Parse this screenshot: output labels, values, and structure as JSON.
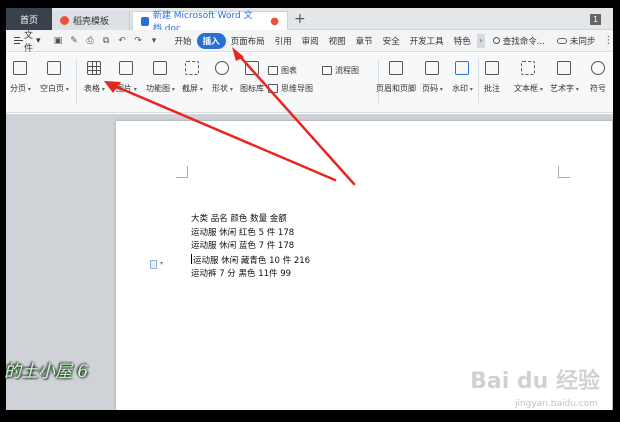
{
  "tabbar": {
    "tabs": [
      {
        "label": "首页"
      },
      {
        "label": "稻壳模板"
      },
      {
        "label": "新建 Microsoft Word 文档.doc"
      }
    ],
    "new_tab": "+",
    "badge": "1"
  },
  "menubar": {
    "file_label": "文件",
    "file_arrow": "▾",
    "tabs": [
      "开始",
      "插入",
      "页面布局",
      "引用",
      "审阅",
      "视图",
      "章节",
      "安全",
      "开发工具",
      "特色"
    ],
    "active_tab": "插入",
    "more": "›",
    "search": "查找命令...",
    "sync": "未同步",
    "kebab": "⋮"
  },
  "ribbon": {
    "page": "分页",
    "blank_page": "空白页",
    "table": "表格",
    "picture": "图片",
    "function_chart": "功能图",
    "screenshot": "截屏",
    "shape": "形状",
    "icon_lib": "图标库",
    "chart": "图表",
    "mindmap": "思维导图",
    "flowchart": "流程图",
    "header_footer": "页眉和页脚",
    "page_number": "页码",
    "watermark": "水印",
    "comment": "批注",
    "textbox": "文本框",
    "wordart": "艺术字",
    "symbol": "符号"
  },
  "document": {
    "lines": [
      "大类 品名 颜色 数量 金额",
      "运动服 休闲 红色 5 件 178",
      "运动服 休闲 蓝色 7 件 178",
      "运动服 休闲 藏青色 10 件 216",
      "运动裤 7 分 黑色 11件 99"
    ]
  },
  "watermarks": {
    "baidu": "Bai du 经验",
    "url": "jingyan.baidu.com",
    "author": "的土小屋 6"
  },
  "colors": {
    "accent": "#2a6fd6",
    "arrow": "#e8261f"
  }
}
